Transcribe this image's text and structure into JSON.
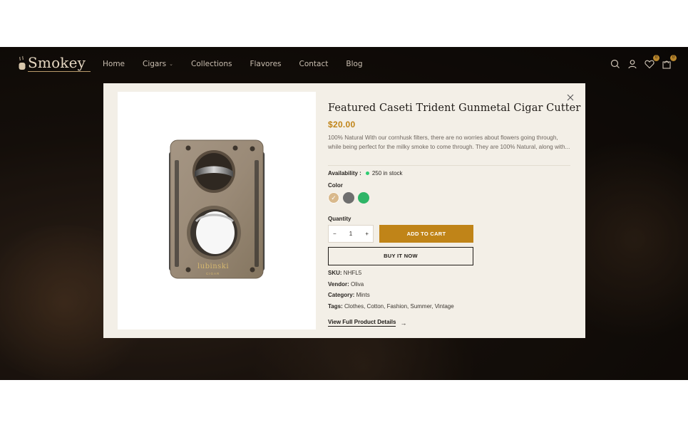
{
  "brand": {
    "name": "Smokey"
  },
  "nav": {
    "items": [
      {
        "label": "Home"
      },
      {
        "label": "Cigars",
        "has_dropdown": true
      },
      {
        "label": "Collections"
      },
      {
        "label": "Flavores"
      },
      {
        "label": "Contact"
      },
      {
        "label": "Blog"
      }
    ]
  },
  "header_icons": {
    "search": "search-icon",
    "account": "user-icon",
    "wishlist": {
      "icon": "heart-icon",
      "count": "0"
    },
    "cart": {
      "icon": "bag-icon",
      "count": "0"
    }
  },
  "product": {
    "title": "Featured Caseti Trident Gunmetal Cigar Cutter",
    "price": "$20.00",
    "description": "100% Natural With our cornhusk filters, there are no worries about flowers going through, while being perfect for the milky smoke to come through. They are 100% Natural, along with...",
    "availability_label": "Availability :",
    "availability_value": "250 in stock",
    "color_label": "Color",
    "colors": [
      {
        "name": "beige",
        "hex": "#d9b98c",
        "selected": true
      },
      {
        "name": "gray",
        "hex": "#6e6e6e",
        "selected": false
      },
      {
        "name": "green",
        "hex": "#2eb567",
        "selected": false
      }
    ],
    "quantity_label": "Quantity",
    "quantity": "1",
    "qty_minus": "−",
    "qty_plus": "+",
    "add_to_cart": "ADD TO CART",
    "buy_now": "BUY IT NOW",
    "sku_label": "SKU:",
    "sku": "NHFL5",
    "vendor_label": "Vendor:",
    "vendor": "Oliva",
    "category_label": "Category:",
    "category": "Mints",
    "tags_label": "Tags:",
    "tags": "Clothes, Cotton, Fashion, Summer, Vintage",
    "details_link": "View Full Product Details",
    "image_brand_text": "lubinski",
    "image_brand_sub": "CIGAR"
  },
  "colors": {
    "accent": "#c08418",
    "modal_bg": "#f3efe7",
    "in_stock": "#2ecc71"
  }
}
